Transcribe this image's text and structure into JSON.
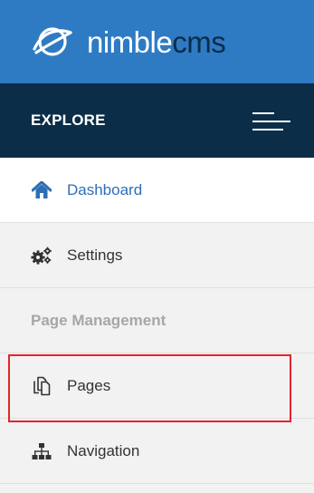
{
  "brand": {
    "name_part1": "nimble",
    "name_part2": "cms",
    "logo_icon": "globe-swoosh-icon",
    "background": "#2e7bc4",
    "accent": "#0b2b4a"
  },
  "explore": {
    "label": "EXPLORE",
    "toggle_icon": "hamburger-menu-icon",
    "background": "#0b2d48"
  },
  "nav": {
    "items": [
      {
        "label": "Dashboard",
        "icon": "home-icon",
        "active": true
      },
      {
        "label": "Settings",
        "icon": "cogs-icon",
        "active": false
      },
      {
        "label": "Pages",
        "icon": "copy-pages-icon",
        "active": false
      },
      {
        "label": "Navigation",
        "icon": "sitemap-icon",
        "active": false
      }
    ],
    "section_label": "Page Management",
    "active_color": "#2e6fb3"
  },
  "highlight": {
    "color": "#e3242b"
  }
}
